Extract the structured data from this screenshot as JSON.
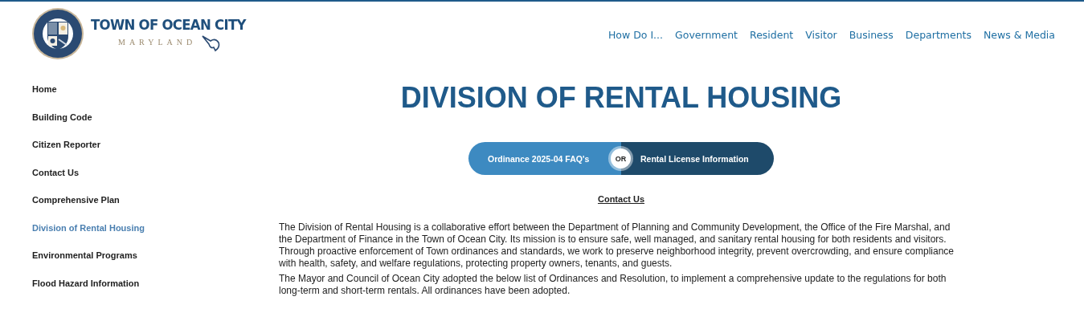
{
  "logo": {
    "title": "TOWN OF OCEAN CITY",
    "subtitle": "MARYLAND"
  },
  "nav": [
    {
      "label": "How Do I..."
    },
    {
      "label": "Government"
    },
    {
      "label": "Resident"
    },
    {
      "label": "Visitor"
    },
    {
      "label": "Business"
    },
    {
      "label": "Departments"
    },
    {
      "label": "News & Media"
    }
  ],
  "sidebar": {
    "items": [
      {
        "label": "Home",
        "selected": false
      },
      {
        "label": "Building Code",
        "selected": false
      },
      {
        "label": "Citizen Reporter",
        "selected": false
      },
      {
        "label": "Contact Us",
        "selected": false
      },
      {
        "label": "Comprehensive Plan",
        "selected": false
      },
      {
        "label": "Division of Rental Housing",
        "selected": true
      },
      {
        "label": "Environmental Programs",
        "selected": false
      },
      {
        "label": "Flood Hazard Information",
        "selected": false
      }
    ]
  },
  "page_title": "DIVISION OF RENTAL HOUSING",
  "split_button": {
    "left": "Ordinance 2025-04 FAQ's",
    "divider": "OR",
    "right": "Rental License Information"
  },
  "contact_link": "Contact Us",
  "paragraphs": [
    "The Division of Rental Housing is a collaborative effort between the Department of Planning and Community Development, the Office of the Fire Marshal, and the Department of Finance in the Town of Ocean City. Its mission is to ensure safe, well managed, and sanitary rental housing for both residents and visitors. Through proactive enforcement of Town ordinances and standards, we work to preserve neighborhood integrity, prevent overcrowding, and ensure compliance with health, safety, and welfare regulations, protecting property owners, tenants, and guests.",
    "The Mayor and Council of Ocean City adopted the below list of Ordinances and Resolution, to implement a comprehensive update to the regulations for both long-term and short-term rentals. All ordinances have been adopted."
  ]
}
